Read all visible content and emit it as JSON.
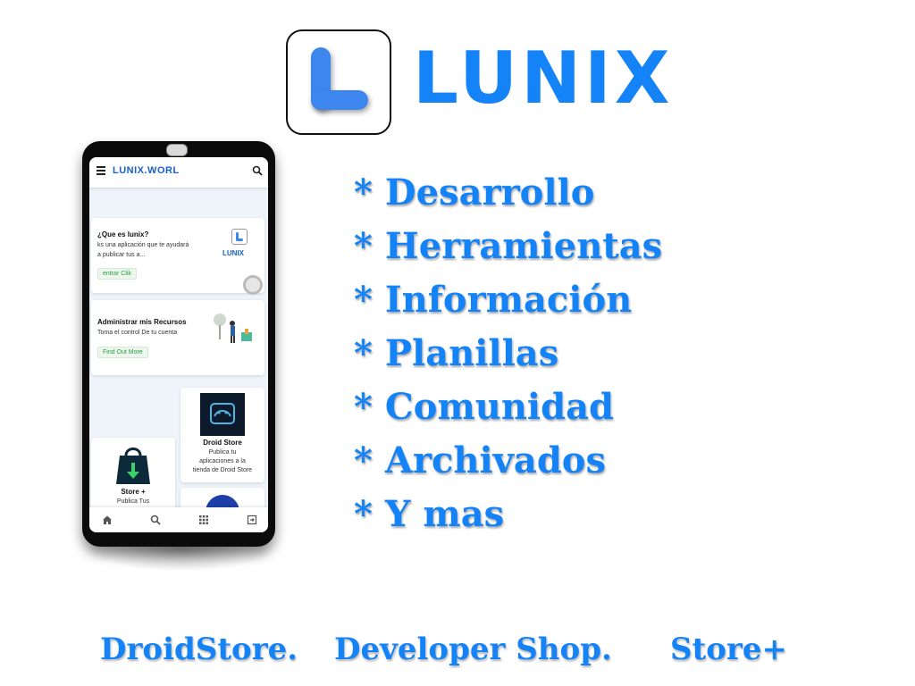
{
  "brand": {
    "name": "LUNIX",
    "color": "#1483f7"
  },
  "features": [
    {
      "bullet": "*",
      "label": "Desarrollo"
    },
    {
      "bullet": "*",
      "label": "Herramientas"
    },
    {
      "bullet": "*",
      "label": "Información"
    },
    {
      "bullet": "*",
      "label": "Planillas"
    },
    {
      "bullet": "*",
      "label": "Comunidad"
    },
    {
      "bullet": "*",
      "label": "Archivados"
    },
    {
      "bullet": "*",
      "label": "Y mas"
    }
  ],
  "footer": {
    "items": [
      "DroidStore.",
      "Developer Shop.",
      "Store+"
    ]
  },
  "phone": {
    "app_title": "LUNIX.WORL",
    "card_about": {
      "title": "¿Que es lunix?",
      "desc_line1": "ks una aplicación que te ayudará",
      "desc_line2": "a publicar tus a...",
      "button": "entrar Clik",
      "logo_text": "LUNIX"
    },
    "card_resources": {
      "title": "Administrar mis Recursos",
      "desc": "Toma el control De tu cuenta",
      "button": "Find Out More"
    },
    "card_droid": {
      "title": "Droid Store",
      "desc_line1": "Publica tu",
      "desc_line2": "aplicaciones a la",
      "desc_line3": "tienda de Droid Store"
    },
    "card_store": {
      "title": "Store +",
      "desc": "Publica Tus"
    },
    "nav_icons": [
      "home-icon",
      "search-icon",
      "grid-icon",
      "exit-icon"
    ]
  }
}
